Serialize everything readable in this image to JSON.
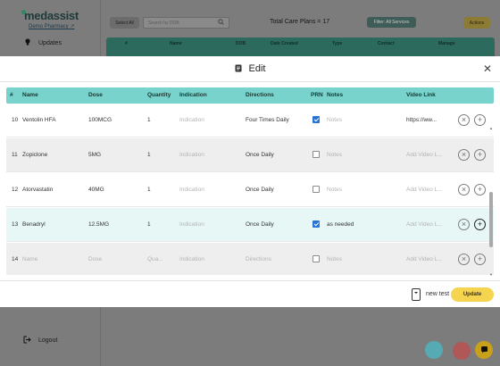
{
  "app": {
    "logo": "medassist",
    "pharmacy": "Demo Pharmacy",
    "nav": {
      "updates": "Updates",
      "logout": "Logout"
    }
  },
  "toolbar": {
    "select_all": "Select All",
    "search_placeholder": "Search by DOB",
    "total_care_plans": "Total Care Plans = 17",
    "filter": "Filter: All Services",
    "actions": "Actions"
  },
  "background_table": {
    "headers": [
      "#",
      "Name",
      "DOB",
      "Date Created",
      "Type",
      "Contact",
      "Manage"
    ]
  },
  "modal": {
    "title": "Edit",
    "columns": {
      "num": "#",
      "name": "Name",
      "dose": "Dose",
      "quantity": "Quantity",
      "indication": "Indication",
      "directions": "Directions",
      "prn": "PRN",
      "notes": "Notes",
      "video_link": "Video Link"
    },
    "placeholders": {
      "name": "Name",
      "dose": "Dose",
      "quantity": "Qua...",
      "indication": "Indication",
      "directions": "Directions",
      "notes": "Notes",
      "video": "Add Video L..."
    },
    "rows": [
      {
        "num": "10",
        "name": "Ventolin HFA",
        "dose": "100MCG",
        "quantity": "1",
        "indication": "",
        "directions": "Four Times Daily",
        "prn": true,
        "notes": "",
        "video": "https://ww..."
      },
      {
        "num": "11",
        "name": "Zopiclone",
        "dose": "5MG",
        "quantity": "1",
        "indication": "",
        "directions": "Once Daily",
        "prn": false,
        "notes": "",
        "video": ""
      },
      {
        "num": "12",
        "name": "Atorvastatin",
        "dose": "40MG",
        "quantity": "1",
        "indication": "",
        "directions": "Once Daily",
        "prn": false,
        "notes": "",
        "video": ""
      },
      {
        "num": "13",
        "name": "Benadryl",
        "dose": "12.5MG",
        "quantity": "1",
        "indication": "",
        "directions": "Once Daily",
        "prn": true,
        "notes": "as needed",
        "video": ""
      },
      {
        "num": "14",
        "name": "",
        "dose": "",
        "quantity": "",
        "indication": "",
        "directions": "",
        "prn": false,
        "notes": "",
        "video": ""
      }
    ],
    "footer": {
      "test_label": "new test",
      "update": "Update"
    }
  },
  "colors": {
    "table_header": "#78d3cc",
    "accent_yellow": "#f5d550",
    "checkbox": "#2a73d6"
  }
}
